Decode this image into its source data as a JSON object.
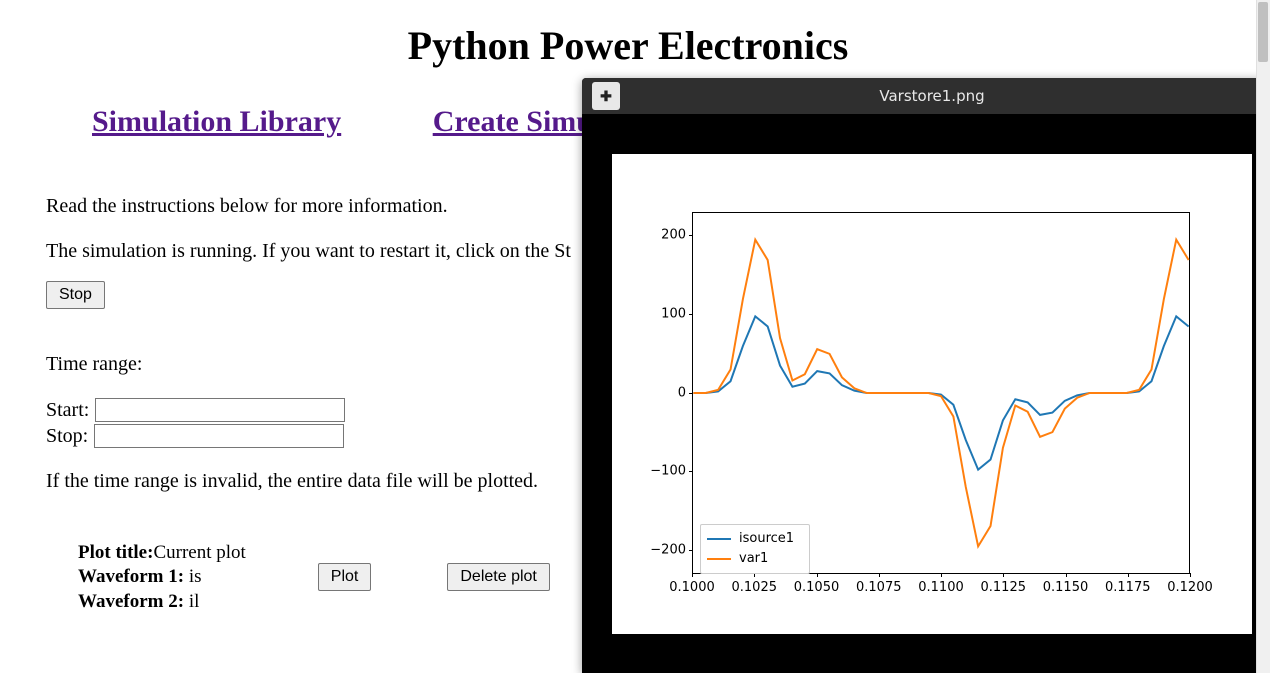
{
  "page": {
    "title": "Python Power Electronics"
  },
  "nav": {
    "simulation_library": "Simulation Library",
    "create_simulation": "Create Simu"
  },
  "instructions": {
    "line1": "Read the instructions below for more information.",
    "line2": "The simulation is running. If you want to restart it, click on the St"
  },
  "buttons": {
    "stop": "Stop",
    "plot": "Plot",
    "delete_plot": "Delete plot"
  },
  "time_range": {
    "label": "Time range:",
    "start_label": "Start:",
    "stop_label": "Stop:",
    "start_value": "",
    "stop_value": "",
    "notice": "If the time range is invalid, the entire data file will be plotted."
  },
  "plot_item": {
    "title_label": "Plot title:",
    "title_value": "Current plot",
    "wave1_label": "Waveform 1: ",
    "wave1_value": "is",
    "wave2_label": "Waveform 2: ",
    "wave2_value": "il"
  },
  "viewer": {
    "menu_glyph": "✚",
    "title": "Varstore1.png"
  },
  "chart_data": {
    "type": "line",
    "x_ticks": [
      "0.1000",
      "0.1025",
      "0.1050",
      "0.1075",
      "0.1100",
      "0.1125",
      "0.1150",
      "0.1175",
      "0.1200"
    ],
    "y_ticks": [
      -200,
      -100,
      0,
      100,
      200
    ],
    "xlim": [
      0.1,
      0.12
    ],
    "ylim": [
      -230,
      230
    ],
    "colors": {
      "isource1": "#1f77b4",
      "var1": "#ff7f0e"
    },
    "legend": [
      "isource1",
      "var1"
    ],
    "series": [
      {
        "name": "isource1",
        "x": [
          0.1,
          0.1005,
          0.101,
          0.1015,
          0.102,
          0.1025,
          0.103,
          0.1035,
          0.104,
          0.1045,
          0.105,
          0.1055,
          0.106,
          0.1065,
          0.107,
          0.1075,
          0.108,
          0.1085,
          0.109,
          0.1095,
          0.11,
          0.1105,
          0.111,
          0.1115,
          0.112,
          0.1125,
          0.113,
          0.1135,
          0.114,
          0.1145,
          0.115,
          0.1155,
          0.116,
          0.1165,
          0.117,
          0.1175,
          0.118,
          0.1185,
          0.119,
          0.1195,
          0.12
        ],
        "y": [
          0,
          0,
          2,
          15,
          60,
          98,
          85,
          35,
          8,
          12,
          28,
          25,
          10,
          3,
          0,
          0,
          0,
          0,
          0,
          0,
          -2,
          -15,
          -60,
          -98,
          -85,
          -35,
          -8,
          -12,
          -28,
          -25,
          -10,
          -3,
          0,
          0,
          0,
          0,
          2,
          15,
          60,
          98,
          85
        ]
      },
      {
        "name": "var1",
        "x": [
          0.1,
          0.1005,
          0.101,
          0.1015,
          0.102,
          0.1025,
          0.103,
          0.1035,
          0.104,
          0.1045,
          0.105,
          0.1055,
          0.106,
          0.1065,
          0.107,
          0.1075,
          0.108,
          0.1085,
          0.109,
          0.1095,
          0.11,
          0.1105,
          0.111,
          0.1115,
          0.112,
          0.1125,
          0.113,
          0.1135,
          0.114,
          0.1145,
          0.115,
          0.1155,
          0.116,
          0.1165,
          0.117,
          0.1175,
          0.118,
          0.1185,
          0.119,
          0.1195,
          0.12
        ],
        "y": [
          0,
          0,
          4,
          30,
          120,
          196,
          170,
          70,
          16,
          24,
          56,
          50,
          20,
          6,
          0,
          0,
          0,
          0,
          0,
          0,
          -4,
          -30,
          -120,
          -196,
          -170,
          -70,
          -16,
          -24,
          -56,
          -50,
          -20,
          -6,
          0,
          0,
          0,
          0,
          4,
          30,
          120,
          196,
          170
        ]
      }
    ]
  }
}
